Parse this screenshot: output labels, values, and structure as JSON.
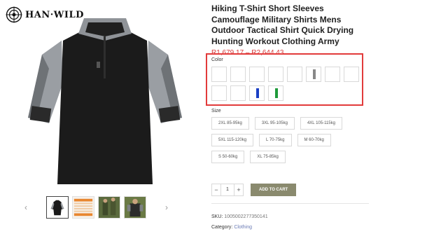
{
  "brand": {
    "name": "HAN·WILD"
  },
  "product": {
    "title": "Hiking T-Shirt Short Sleeves Camouflage Military Shirts Mens Outdoor Tactical Shirt Quick Drying Hunting Workout Clothing Army",
    "price": "R1,679.17 – R2,644.43"
  },
  "color": {
    "label": "Color",
    "swatches": [
      {
        "name": "white"
      },
      {
        "name": "white"
      },
      {
        "name": "white"
      },
      {
        "name": "white"
      },
      {
        "name": "white"
      },
      {
        "name": "gray",
        "bar": "#888888"
      },
      {
        "name": "white"
      },
      {
        "name": "white"
      },
      {
        "name": "white"
      },
      {
        "name": "white"
      },
      {
        "name": "blue",
        "bar": "#1a3fc4"
      },
      {
        "name": "green",
        "bar": "#1e9a3a"
      }
    ]
  },
  "size": {
    "label": "Size",
    "options": [
      "2XL 85-95kg",
      "3XL 95-105kg",
      "4XL 105-115kg",
      "5XL 115-120kg",
      "L 70-75kg",
      "M 60-70kg",
      "S 50-60kg",
      "XL 75-85kg"
    ]
  },
  "cart": {
    "qty_minus": "−",
    "qty": "1",
    "qty_plus": "+",
    "add_label": "ADD TO CART"
  },
  "meta": {
    "sku_key": "SKU:",
    "sku_val": "1005002277350141",
    "cat_key": "Category:",
    "cat_val": "Clothing"
  },
  "gallery": {
    "prev": "‹",
    "next": "›"
  },
  "colors": {
    "accent": "#e23b3b",
    "price": "#d63a3a",
    "button": "#8a8a6e"
  }
}
